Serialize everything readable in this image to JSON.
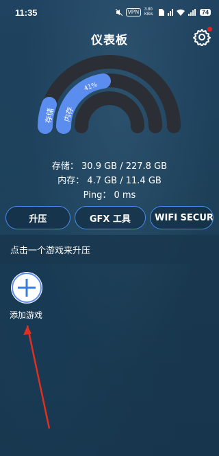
{
  "status_bar": {
    "time": "11:35",
    "speed": "3.80 KB/s",
    "vpn": "VPN",
    "battery": "74"
  },
  "header": {
    "title": "仪表板"
  },
  "gauge": {
    "storage_label": "存储",
    "memory_label": "内存",
    "memory_percent_label": "41%",
    "memory_fraction": 0.41,
    "storage_fraction": 0.14,
    "colors": {
      "track": "#2b2f35",
      "fill": "#5b8def"
    }
  },
  "stats": {
    "storage_text": "存储： 30.9 GB / 227.8 GB",
    "memory_text": "内存： 4.7 GB / 11.4 GB",
    "ping_text": "Ping： 0 ms"
  },
  "buttons": {
    "boost": "升压",
    "gfx": "GFX 工具",
    "wifi": "WIFI SECUR…"
  },
  "hint": "点击一个游戏来升压",
  "add_game": {
    "label": "添加游戏"
  }
}
